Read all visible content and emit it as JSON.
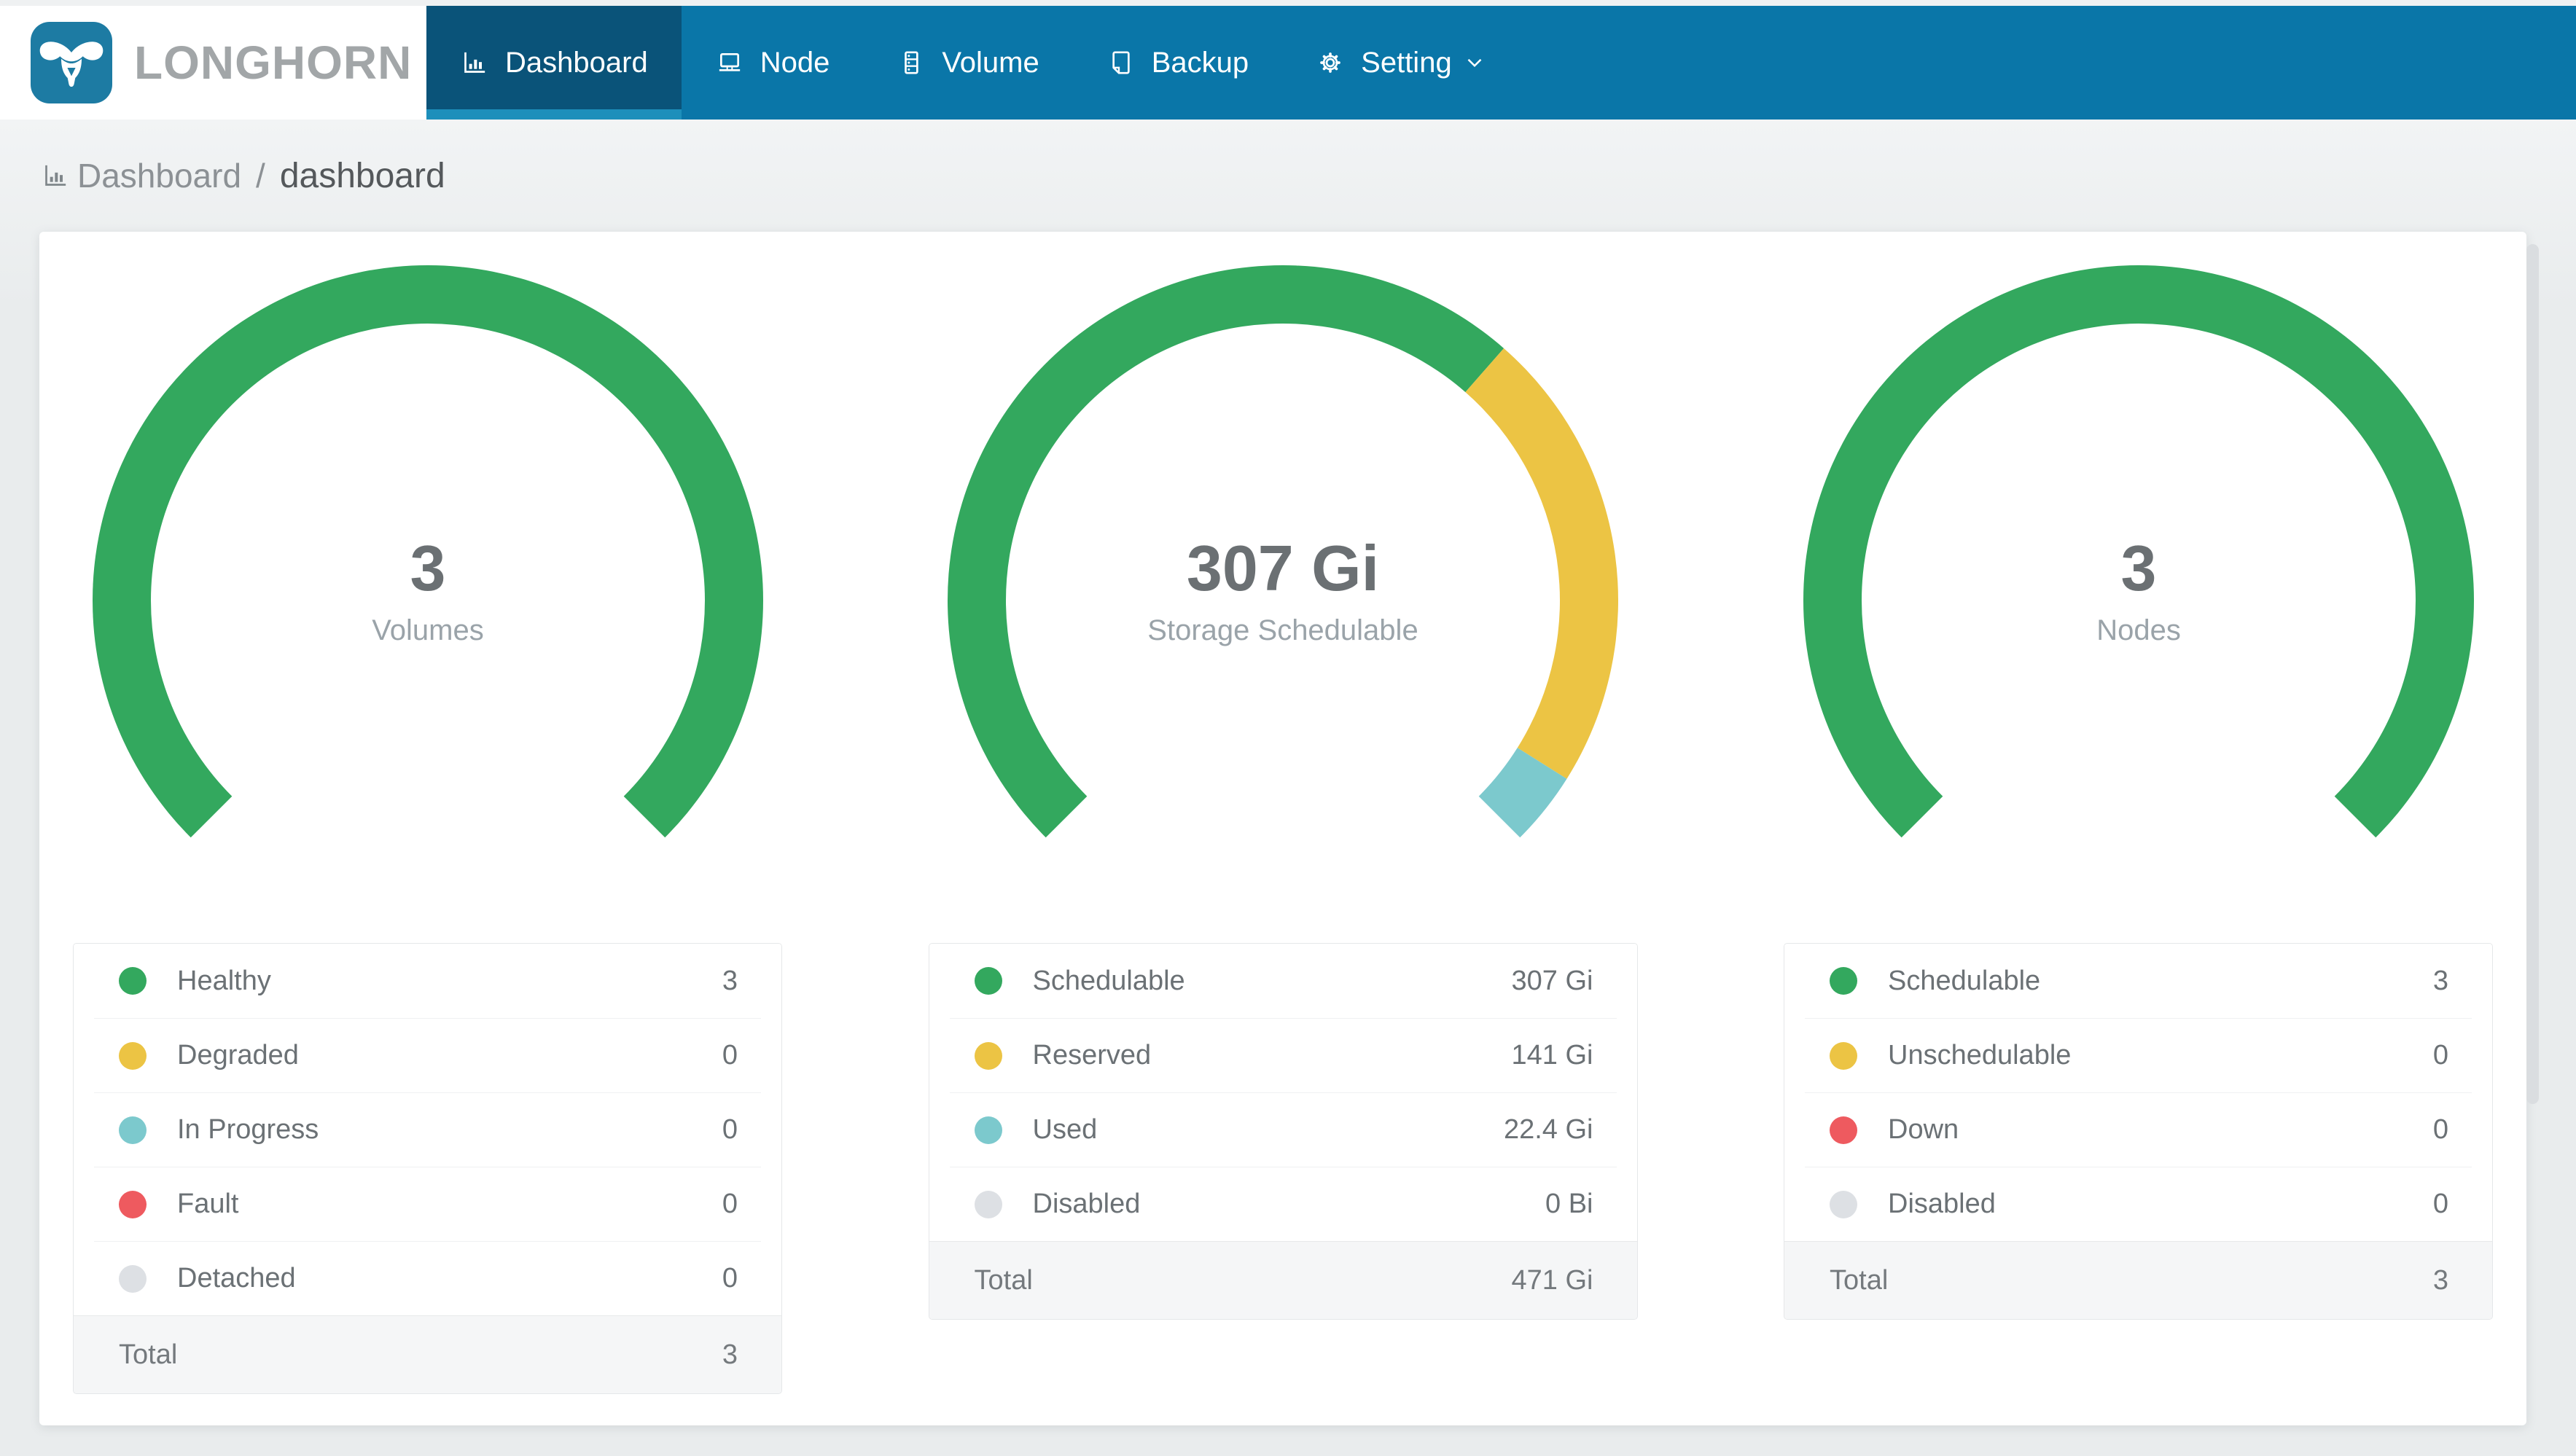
{
  "brand": {
    "name": "LONGHORN"
  },
  "colors": {
    "navbar_bg": "#0a76a8",
    "navbar_active_bg": "#0a5379",
    "navbar_active_underline": "#1d8fbb",
    "logo_bg": "#1d7ba3",
    "healthy_green": "#33a85e",
    "warning_yellow": "#ecc444",
    "progress_teal": "#7cc9cd",
    "fault_red": "#ee5a5f",
    "disabled_gray": "#dde0e4"
  },
  "nav": {
    "items": [
      {
        "label": "Dashboard",
        "icon": "bar-chart-icon",
        "active": true
      },
      {
        "label": "Node",
        "icon": "laptop-icon",
        "active": false
      },
      {
        "label": "Volume",
        "icon": "server-icon",
        "active": false
      },
      {
        "label": "Backup",
        "icon": "document-icon",
        "active": false
      },
      {
        "label": "Setting",
        "icon": "gear-icon",
        "active": false,
        "dropdown": true
      }
    ]
  },
  "breadcrumb": {
    "icon": "bar-chart-icon",
    "section": "Dashboard",
    "separator": "/",
    "current": "dashboard"
  },
  "chart_data": [
    {
      "type": "pie",
      "variant": "gauge-donut",
      "title": "Volumes",
      "center_value": "3",
      "center_label": "Volumes",
      "start_angle_deg": 225,
      "sweep_deg": 270,
      "segments": [
        {
          "label": "Healthy",
          "value": 3,
          "display": "3",
          "color": "#33a85e"
        },
        {
          "label": "Degraded",
          "value": 0,
          "display": "0",
          "color": "#ecc444"
        },
        {
          "label": "In Progress",
          "value": 0,
          "display": "0",
          "color": "#7cc9cd"
        },
        {
          "label": "Fault",
          "value": 0,
          "display": "0",
          "color": "#ee5a5f"
        },
        {
          "label": "Detached",
          "value": 0,
          "display": "0",
          "color": "#dde0e4"
        }
      ],
      "total": {
        "label": "Total",
        "value": 3,
        "display": "3"
      }
    },
    {
      "type": "pie",
      "variant": "gauge-donut",
      "title": "Storage Schedulable",
      "center_value": "307 Gi",
      "center_label": "Storage Schedulable",
      "start_angle_deg": 225,
      "sweep_deg": 270,
      "segments": [
        {
          "label": "Schedulable",
          "value": 307,
          "display": "307 Gi",
          "color": "#33a85e"
        },
        {
          "label": "Reserved",
          "value": 141,
          "display": "141 Gi",
          "color": "#ecc444"
        },
        {
          "label": "Used",
          "value": 22.4,
          "display": "22.4 Gi",
          "color": "#7cc9cd"
        },
        {
          "label": "Disabled",
          "value": 0,
          "display": "0 Bi",
          "color": "#dde0e4"
        }
      ],
      "total": {
        "label": "Total",
        "value": 470.4,
        "display": "471 Gi"
      }
    },
    {
      "type": "pie",
      "variant": "gauge-donut",
      "title": "Nodes",
      "center_value": "3",
      "center_label": "Nodes",
      "start_angle_deg": 225,
      "sweep_deg": 270,
      "segments": [
        {
          "label": "Schedulable",
          "value": 3,
          "display": "3",
          "color": "#33a85e"
        },
        {
          "label": "Unschedulable",
          "value": 0,
          "display": "0",
          "color": "#ecc444"
        },
        {
          "label": "Down",
          "value": 0,
          "display": "0",
          "color": "#ee5a5f"
        },
        {
          "label": "Disabled",
          "value": 0,
          "display": "0",
          "color": "#dde0e4"
        }
      ],
      "total": {
        "label": "Total",
        "value": 3,
        "display": "3"
      }
    }
  ]
}
